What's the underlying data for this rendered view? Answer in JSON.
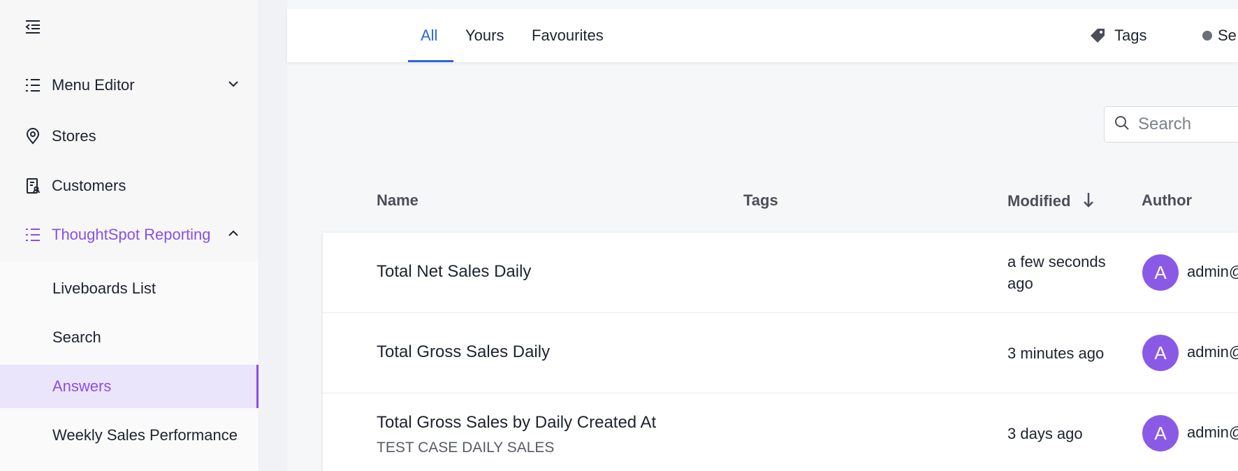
{
  "sidebar": {
    "items": [
      {
        "label": "Menu Editor",
        "icon": "list-icon"
      },
      {
        "label": "Stores",
        "icon": "location-pin-icon"
      },
      {
        "label": "Customers",
        "icon": "customer-book-icon"
      },
      {
        "label": "ThoughtSpot Reporting",
        "icon": "list-icon"
      }
    ],
    "subitems": [
      {
        "label": "Liveboards List"
      },
      {
        "label": "Search"
      },
      {
        "label": "Answers"
      },
      {
        "label": "Weekly Sales Performance"
      }
    ]
  },
  "topbar": {
    "tabs": [
      {
        "label": "All"
      },
      {
        "label": "Yours"
      },
      {
        "label": "Favourites"
      }
    ],
    "tags_label": "Tags",
    "select_label": "Se"
  },
  "search": {
    "placeholder": "Search"
  },
  "table": {
    "columns": {
      "name": "Name",
      "tags": "Tags",
      "modified": "Modified",
      "author": "Author"
    },
    "rows": [
      {
        "name": "Total Net Sales Daily",
        "desc": "",
        "modified": "a few seconds ago",
        "avatar": "A",
        "author": "admin@"
      },
      {
        "name": "Total Gross Sales Daily",
        "desc": "",
        "modified": "3 minutes ago",
        "avatar": "A",
        "author": "admin@"
      },
      {
        "name": "Total Gross Sales by Daily Created At",
        "desc": "TEST CASE DAILY SALES",
        "modified": "3 days ago",
        "avatar": "A",
        "author": "admin@"
      }
    ]
  },
  "colors": {
    "accent": "#8a4fe6",
    "tab_active": "#2b66d9",
    "avatar": "#8a5ae6"
  }
}
